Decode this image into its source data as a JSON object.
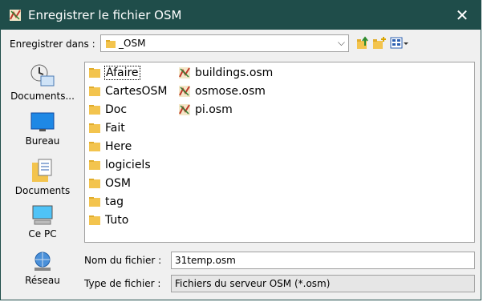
{
  "window": {
    "title": "Enregistrer le fichier OSM",
    "close_glyph": "✕",
    "accent": "#1f4d4a"
  },
  "toolbar": {
    "save_in_label": "Enregistrer dans :",
    "current_folder": "_OSM"
  },
  "places": [
    {
      "label": "Documents...",
      "icon": "recent-documents-icon"
    },
    {
      "label": "Bureau",
      "icon": "desktop-icon"
    },
    {
      "label": "Documents",
      "icon": "documents-icon"
    },
    {
      "label": "Ce PC",
      "icon": "computer-icon"
    },
    {
      "label": "Réseau",
      "icon": "network-icon"
    }
  ],
  "folders": [
    "Afaire",
    "CartesOSM",
    "Doc",
    "Fait",
    "Here",
    "logiciels",
    "OSM",
    "tag",
    "Tuto"
  ],
  "files": [
    "buildings.osm",
    "osmose.osm",
    "pi.osm"
  ],
  "form": {
    "filename_label": "Nom du fichier :",
    "filename_value": "31temp.osm",
    "filetype_label": "Type de fichier :",
    "filetype_value": "Fichiers du serveur OSM (*.osm)"
  }
}
